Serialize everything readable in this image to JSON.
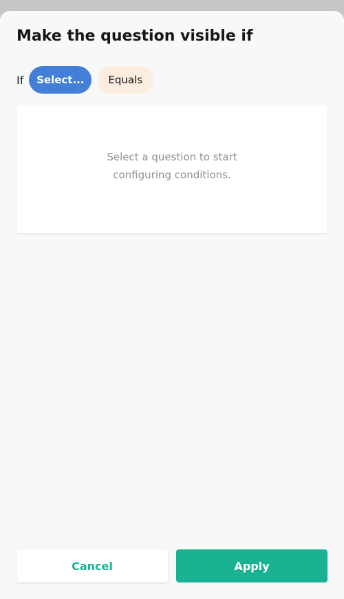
{
  "dialog": {
    "title": "Make the question visible if"
  },
  "condition": {
    "if_label": "If",
    "question_select": "Select...",
    "operator": "Equals"
  },
  "empty_state": {
    "message": "Select a question to start configuring conditions."
  },
  "footer": {
    "cancel_label": "Cancel",
    "apply_label": "Apply"
  },
  "colors": {
    "accent": "#19b394",
    "select_pill": "#437fd9",
    "operator_pill": "#fbeee0"
  }
}
